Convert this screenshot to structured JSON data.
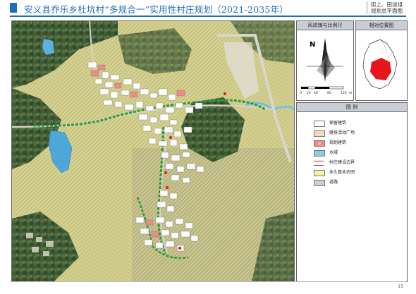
{
  "header": {
    "title": "安义县乔乐乡杜坑村“多规合一”实用性村庄规划（2021-2035年）",
    "subtitle_line1": "街上、田垅组",
    "subtitle_line2": "规划总平面图",
    "accent_color": "#1f6fb6"
  },
  "compass_panel": {
    "heading": "风玫瑰与比例尺",
    "north_label": "N",
    "scale_ticks": [
      "0",
      "20",
      "40",
      "80",
      "120"
    ],
    "scale_unit": "m"
  },
  "location_panel": {
    "heading": "相对位置图",
    "highlight_color": "#e8141b"
  },
  "legend": {
    "heading": "图    例",
    "items": [
      {
        "label": "保留建筑",
        "color": "#ffffff"
      },
      {
        "label": "健身活动广场",
        "color": "#f1dcc0"
      },
      {
        "label": "规划建筑",
        "color": "#f08a86"
      },
      {
        "label": "水域",
        "color": "#8dc9ea"
      },
      {
        "label": "村庄建设边界",
        "color": "#e0222a"
      },
      {
        "label": "永久基本农田",
        "color": "#f7f1a4"
      },
      {
        "label": "道路",
        "color": "#cfcfcf"
      }
    ],
    "extra_mark": "规"
  },
  "page": {
    "number": "15"
  }
}
